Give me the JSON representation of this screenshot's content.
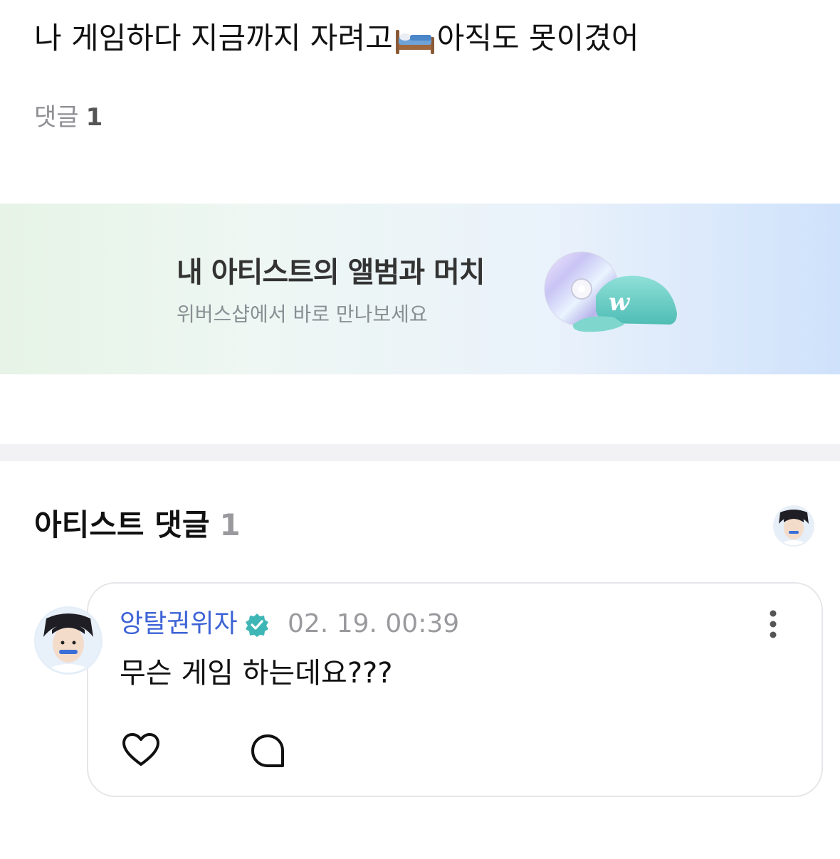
{
  "post": {
    "text_before": "나 게임하다 지금까지 자려고",
    "emoji": "bed-emoji",
    "text_after": "아직도 못이겼어"
  },
  "comments_summary": {
    "label": "댓글",
    "count": "1"
  },
  "banner": {
    "title": "내 아티스트의 앨범과 머치",
    "subtitle": "위버스샵에서 바로 만나보세요",
    "icons": [
      "cd-icon",
      "cap-icon"
    ]
  },
  "artist_comments": {
    "title": "아티스트 댓글",
    "count": "1",
    "avatar": "artist-avatar"
  },
  "comment": {
    "author": "앙탈권위자",
    "verified_icon": "verified-badge-icon",
    "timestamp": "02. 19. 00:39",
    "text": "무슨 게임 하는데요???",
    "actions": {
      "like_icon": "heart-icon",
      "reply_icon": "comment-bubble-icon",
      "more_icon": "more-vertical-icon"
    }
  },
  "colors": {
    "author": "#3d63d6",
    "verified": "#3fb6b6",
    "muted": "#9a9a9e",
    "divider": "#f2f2f4"
  }
}
